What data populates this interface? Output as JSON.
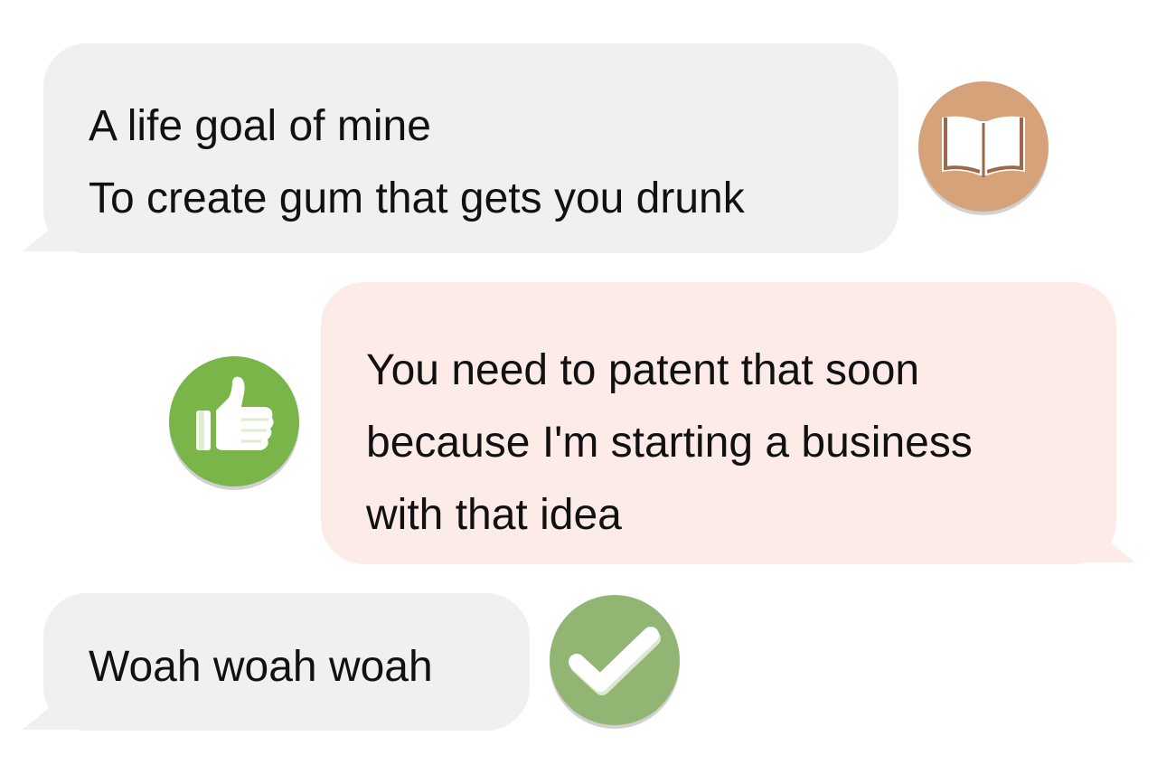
{
  "conversation": {
    "messages": [
      {
        "side": "left",
        "lines": [
          "A life goal of mine",
          "To create gum that gets you drunk"
        ],
        "bubble_color": "#f0f0f0",
        "icon": "open-book-icon",
        "icon_color": "#d6a27a"
      },
      {
        "side": "right",
        "lines": [
          "You need to patent that soon",
          "because I'm starting a business",
          "with that idea"
        ],
        "bubble_color": "#fdebe8",
        "icon": "thumbs-up-icon",
        "icon_color": "#7ab54a"
      },
      {
        "side": "left",
        "lines": [
          "Woah woah woah"
        ],
        "bubble_color": "#f0f0f0",
        "icon": "checkmark-icon",
        "icon_color": "#92b574"
      }
    ]
  }
}
